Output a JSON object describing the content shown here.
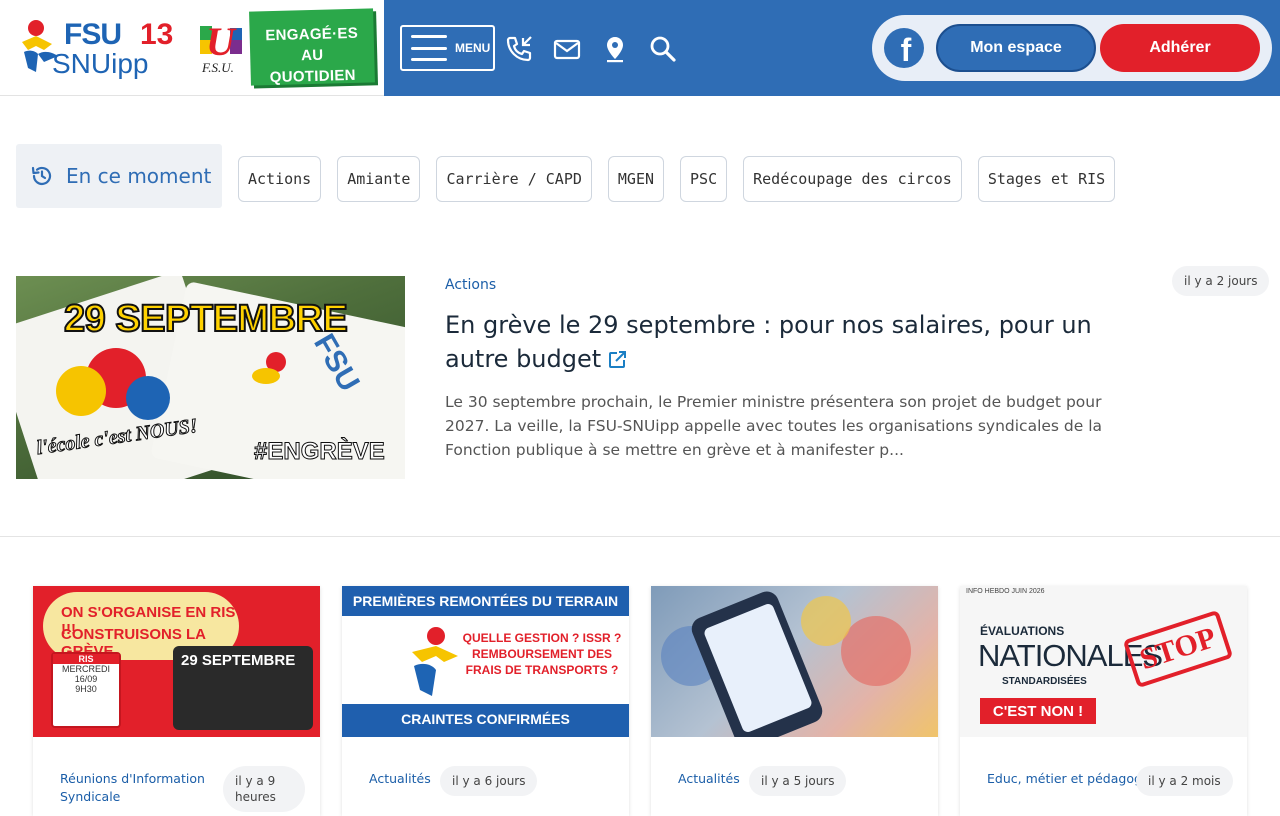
{
  "header": {
    "logo": {
      "fsu": "FSU",
      "number": "13",
      "sub": "SNUipp"
    },
    "union_logo": {
      "letter": "U",
      "sub": "F.S.U."
    },
    "badge": {
      "line1": "ENGAGÉ·ES",
      "line2": "AU QUOTIDIEN"
    },
    "menu_label": "MENU",
    "icons": [
      "phone-icon",
      "mail-icon",
      "location-pin-icon",
      "search-icon"
    ],
    "facebook_glyph": "f",
    "mon_espace": "Mon espace",
    "adherer": "Adhérer",
    "colors": {
      "brand_blue": "#2f6db5",
      "brand_red": "#e2202a",
      "badge_green": "#2ba84a"
    }
  },
  "moment": {
    "label": "En ce moment",
    "tags": [
      "Actions",
      "Amiante",
      "Carrière / CAPD",
      "MGEN",
      "PSC",
      "Redécoupage des circos",
      "Stages et RIS"
    ]
  },
  "featured": {
    "category": "Actions",
    "title": "En grève le 29 septembre : pour nos salaires, pour un autre budget",
    "description": "Le 30 septembre prochain, le Premier ministre présentera son projet de budget pour 2027. La veille, la FSU-SNUipp appelle avec toutes les organisations syndicales de la Fonction publique à se mettre en grève et à manifester p...",
    "time": "il y a 2 jours",
    "image_text": {
      "headline": "29 SEPTEMBRE",
      "fsu": "FSU",
      "school": "l'école c'est NOUS!",
      "hashtag": "#ENGRÈVE"
    }
  },
  "cards": [
    {
      "category": "Réunions d'Information Syndicale",
      "time": "il y a 9 heures",
      "image_text": {
        "line1": "ON S'ORGANISE EN RIS !!!",
        "line2": "CONSTRUISONS LA GRÈVE",
        "date": "29 SEPTEMBRE",
        "cal1": "RIS",
        "cal2": "MERCREDI",
        "cal3": "16/09",
        "cal4": "9H30"
      }
    },
    {
      "category": "Actualités",
      "time": "il y a 6 jours",
      "image_text": {
        "top": "PREMIÈRES REMONTÉES DU TERRAIN",
        "q1": "QUELLE GESTION ? ISSR ?",
        "q2": "REMBOURSEMENT DES",
        "q3": "FRAIS DE TRANSPORTS ?",
        "bottom": "CRAINTES CONFIRMÉES"
      }
    },
    {
      "category": "Actualités",
      "time": "il y a 5 jours",
      "image_text": {}
    },
    {
      "category": "Educ, métier et pédagogie",
      "time": "il y a 2 mois",
      "image_text": {
        "small": "INFO HEBDO JUIN 2026",
        "l1": "ÉVALUATIONS",
        "l2": "NATIONALES",
        "l3": "STANDARDISÉES",
        "l4": "C'EST NON !",
        "stop": "STOP"
      }
    }
  ]
}
